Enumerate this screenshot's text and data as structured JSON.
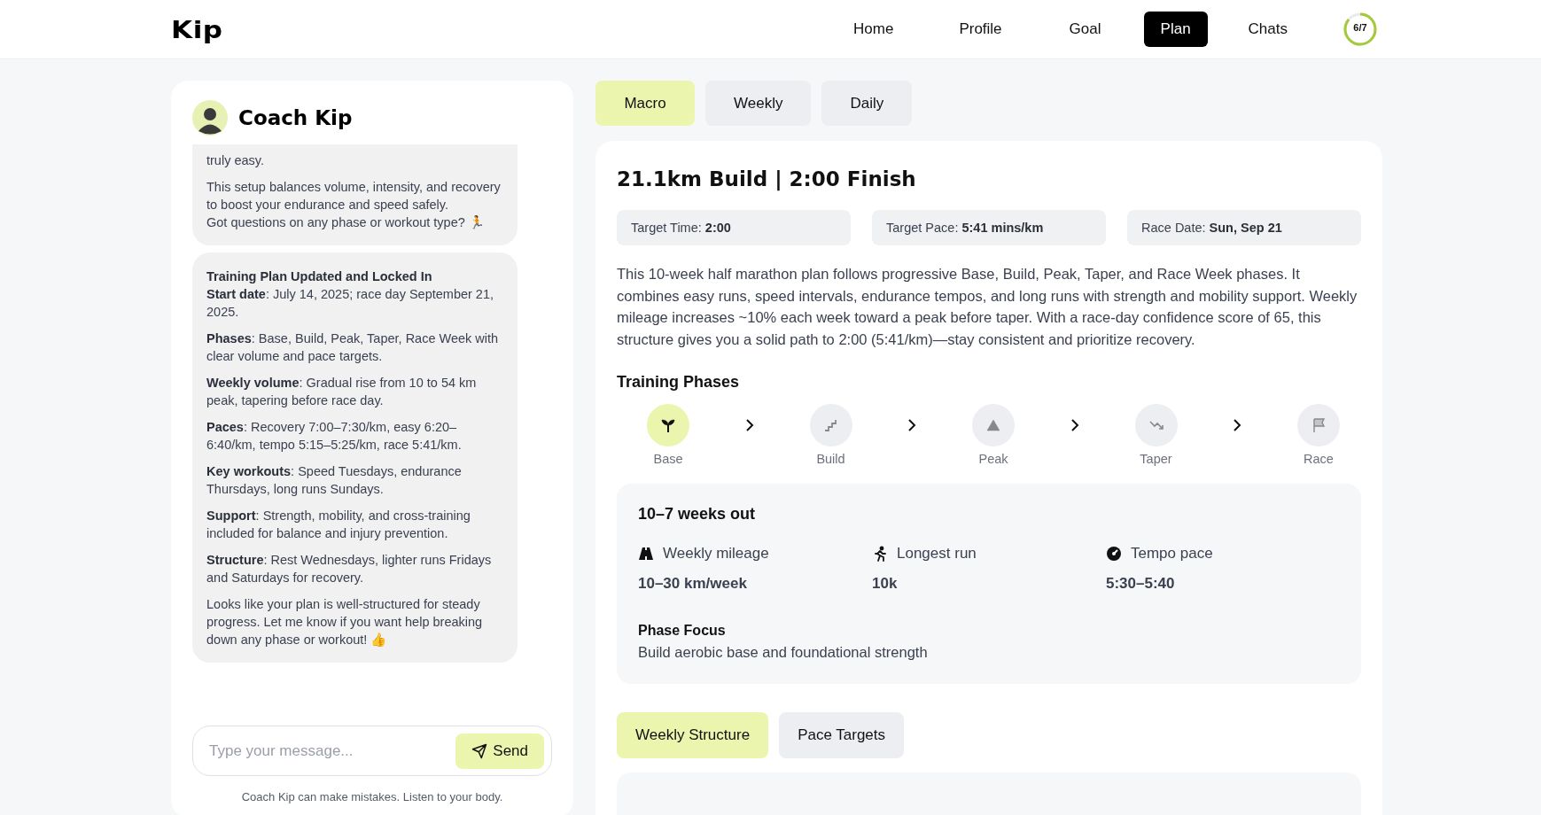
{
  "header": {
    "logo": "Kip",
    "nav": [
      {
        "label": "Home",
        "selected": false
      },
      {
        "label": "Profile",
        "selected": false
      },
      {
        "label": "Goal",
        "selected": false
      },
      {
        "label": "Plan",
        "selected": true
      },
      {
        "label": "Chats",
        "selected": false
      }
    ],
    "progress": {
      "label": "6/7",
      "level": 0.857
    }
  },
  "chat": {
    "title": "Coach Kip",
    "messages": [
      {
        "paragraphs": [
          "truly easy.",
          "This setup balances volume, intensity, and recovery to boost your endurance and speed safely.\nGot questions on any phase or workout type? 🏃"
        ]
      },
      {
        "paragraphs": [
          "**Training Plan Updated and Locked In**\n**Start date**: July 14, 2025; race day September 21, 2025.",
          "**Phases**: Base, Build, Peak, Taper, Race Week with clear volume and pace targets.",
          "**Weekly volume**: Gradual rise from 10 to 54 km peak, tapering before race day.",
          "**Paces**: Recovery 7:00–7:30/km, easy 6:20–6:40/km, tempo 5:15–5:25/km, race 5:41/km.",
          "**Key workouts**: Speed Tuesdays, endurance Thursdays, long runs Sundays.",
          "**Support**: Strength, mobility, and cross-training included for balance and injury prevention.",
          "**Structure**: Rest Wednesdays, lighter runs Fridays and Saturdays for recovery.",
          "Looks like your plan is well-structured for steady progress. Let me know if you want help breaking down any phase or workout! 👍"
        ]
      }
    ],
    "input": {
      "placeholder": "Type your message..."
    },
    "send": "Send",
    "note": "Coach Kip can make mistakes. Listen to your body."
  },
  "view_tabs": [
    {
      "label": "Macro",
      "selected": true
    },
    {
      "label": "Weekly",
      "selected": false
    },
    {
      "label": "Daily",
      "selected": false
    }
  ],
  "plan": {
    "title": "21.1km Build | 2:00 Finish",
    "stats": [
      {
        "label": "Target Time:",
        "value": "2:00"
      },
      {
        "label": "Target Pace:",
        "value": "5:41 mins/km"
      },
      {
        "label": "Race Date:",
        "value": "Sun, Sep 21"
      }
    ],
    "summary": "This 10-week half marathon plan follows progressive Base, Build, Peak, Taper, and Race Week phases. It combines easy runs, speed intervals, endurance tempos, and long runs with strength and mobility support. Weekly mileage increases ~10% each week toward a peak before taper. With a race-day confidence score of 65, this structure gives you a solid path to 2:00 (5:41/km)—stay consistent and prioritize recovery.",
    "phases_title": "Training Phases",
    "phases": [
      {
        "label": "Base",
        "selected": true
      },
      {
        "label": "Build",
        "selected": false
      },
      {
        "label": "Peak",
        "selected": false
      },
      {
        "label": "Taper",
        "selected": false
      },
      {
        "label": "Race",
        "selected": false
      }
    ],
    "phase_detail": {
      "title": "10–7 weeks out",
      "metrics": [
        {
          "label": "Weekly mileage",
          "value": "10–30 km/week"
        },
        {
          "label": "Longest run",
          "value": "10k"
        },
        {
          "label": "Tempo pace",
          "value": "5:30–5:40"
        }
      ],
      "focus_title": "Phase Focus",
      "focus": "Build aerobic base and foundational strength"
    },
    "section_tabs": [
      {
        "label": "Weekly Structure",
        "selected": true
      },
      {
        "label": "Pace Targets",
        "selected": false
      }
    ]
  }
}
